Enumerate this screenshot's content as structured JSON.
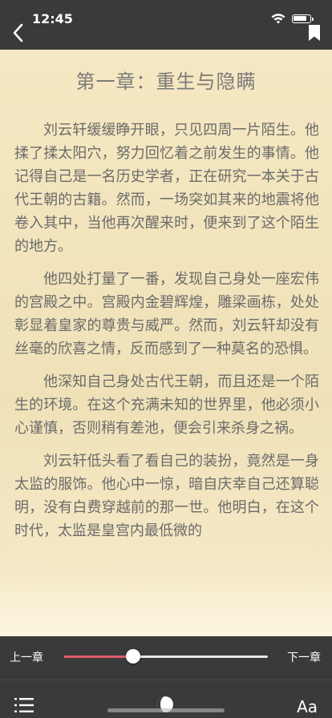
{
  "status": {
    "time": "12:45"
  },
  "chapter": {
    "title": "第一章：重生与隐瞒",
    "paragraphs": [
      "刘云轩缓缓睁开眼，只见四周一片陌生。他揉了揉太阳穴，努力回忆着之前发生的事情。他记得自己是一名历史学者，正在研究一本关于古代王朝的古籍。然而，一场突如其来的地震将他卷入其中，当他再次醒来时，便来到了这个陌生的地方。",
      "他四处打量了一番，发现自己身处一座宏伟的宫殿之中。宫殿内金碧辉煌，雕梁画栋，处处彰显着皇家的尊贵与威严。然而，刘云轩却没有丝毫的欣喜之情，反而感到了一种莫名的恐惧。",
      "他深知自己身处古代王朝，而且还是一个陌生的环境。在这个充满未知的世界里，他必须小心谨慎，否则稍有差池，便会引来杀身之祸。",
      "刘云轩低头看了看自己的装扮，竟然是一身太监的服饰。他心中一惊，暗自庆幸自己还算聪明，没有白费穿越前的那一世。他明白，在这个时代，太监是皇宫内最低微的"
    ]
  },
  "controls": {
    "prev_label": "上一章",
    "next_label": "下一章",
    "progress": 0.34,
    "font_label": "Aa"
  },
  "colors": {
    "bar_bg": "#3a3a3a",
    "page_bg": "#f4e5bb",
    "accent": "#e35a6a"
  },
  "icons": {
    "back": "chevron-left-icon",
    "bookmark": "bookmark-icon",
    "toc": "list-icon",
    "mode": "night-mode-icon"
  }
}
